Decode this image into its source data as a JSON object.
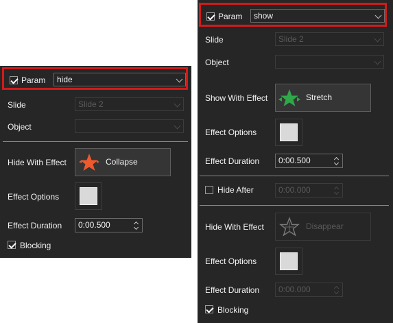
{
  "left": {
    "param_label": "Param",
    "param_value": "hide",
    "slide_label": "Slide",
    "slide_value": "Slide 2",
    "object_label": "Object",
    "object_value": "",
    "effect_label": "Hide With Effect",
    "effect_name": "Collapse",
    "effect_icon": "collapse-star-icon",
    "effect_color": "#ee5a2d",
    "options_label": "Effect Options",
    "duration_label": "Effect Duration",
    "duration_value": "0:00.500",
    "blocking_label": "Blocking"
  },
  "right": {
    "param_label": "Param",
    "param_value": "show",
    "slide_label": "Slide",
    "slide_value": "Slide 2",
    "object_label": "Object",
    "object_value": "",
    "show_effect_label": "Show With Effect",
    "show_effect_name": "Stretch",
    "show_effect_icon": "stretch-star-icon",
    "show_effect_color": "#2fa84a",
    "show_options_label": "Effect Options",
    "show_duration_label": "Effect Duration",
    "show_duration_value": "0:00.500",
    "hide_after_label": "Hide After",
    "hide_after_value": "0:00.000",
    "hide_effect_label": "Hide With Effect",
    "hide_effect_name": "Disappear",
    "hide_effect_icon": "disappear-star-icon",
    "hide_options_label": "Effect Options",
    "hide_duration_label": "Effect Duration",
    "hide_duration_value": "0:00.000",
    "blocking_label": "Blocking"
  },
  "colors": {
    "panel_bg": "#262626",
    "highlight_border": "#d21b1b"
  }
}
